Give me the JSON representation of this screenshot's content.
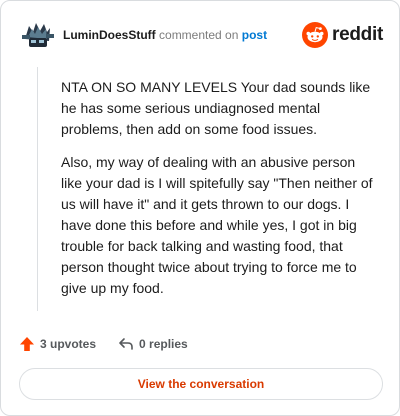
{
  "comment": {
    "username": "LuminDoesStuff",
    "action": "commented on",
    "post_link": "post",
    "paragraphs": [
      "NTA ON SO MANY LEVELS Your dad sounds like he has some serious undiagnosed mental problems, then add on some food issues.",
      "Also, my way of dealing with an abusive person like your dad is I will spitefully say \"Then neither of us will have it\" and it gets thrown to our dogs. I have done this before and while yes, I got in big trouble for back talking and wasting food, that person thought twice about trying to force me to give up my food."
    ]
  },
  "brand": {
    "name": "reddit",
    "color": "#ff4500"
  },
  "stats": {
    "upvotes": "3 upvotes",
    "replies": "0 replies"
  },
  "cta": {
    "label": "View the conversation"
  },
  "icons": {
    "avatar": "avatar",
    "reddit_logo": "reddit-snoo-icon",
    "upvote": "upvote-arrow-icon",
    "reply": "reply-arrow-icon"
  }
}
